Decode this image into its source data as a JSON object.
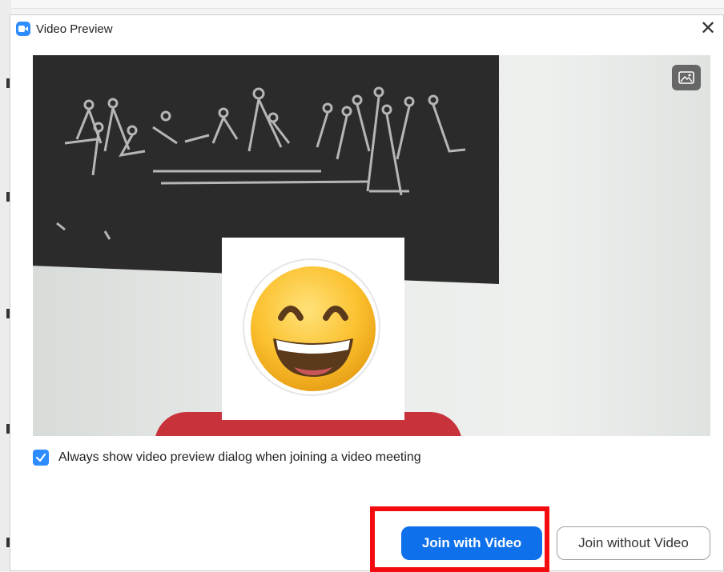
{
  "window": {
    "title": "Video Preview",
    "close_glyph": "✕"
  },
  "video": {
    "overlay_icon": "image-icon",
    "face_emoji": "grinning-face-with-smiling-eyes"
  },
  "preview_setting": {
    "checked": true,
    "label": "Always show video preview dialog when joining a video meeting"
  },
  "actions": {
    "join_with_video": "Join with Video",
    "join_without_video": "Join without Video"
  },
  "colors": {
    "accent": "#0e71eb",
    "checkbox": "#2d8cff",
    "highlight": "#f40b10"
  }
}
